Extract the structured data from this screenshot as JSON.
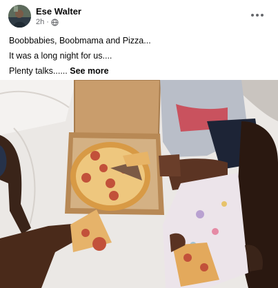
{
  "post": {
    "author": "Ese Walter",
    "time": "2h",
    "dot_separator": "·",
    "privacy_icon": "globe-icon",
    "more_icon": "more-options-icon",
    "lines": [
      "Boobbabies, Boobmama and Pizza...",
      "It was a long night for us....",
      "Plenty talks......"
    ],
    "see_more": "See more",
    "photo_description_icon": "photo-pizza"
  },
  "colors": {
    "text_primary": "#050505",
    "text_secondary": "#65676b",
    "background": "#ffffff"
  }
}
